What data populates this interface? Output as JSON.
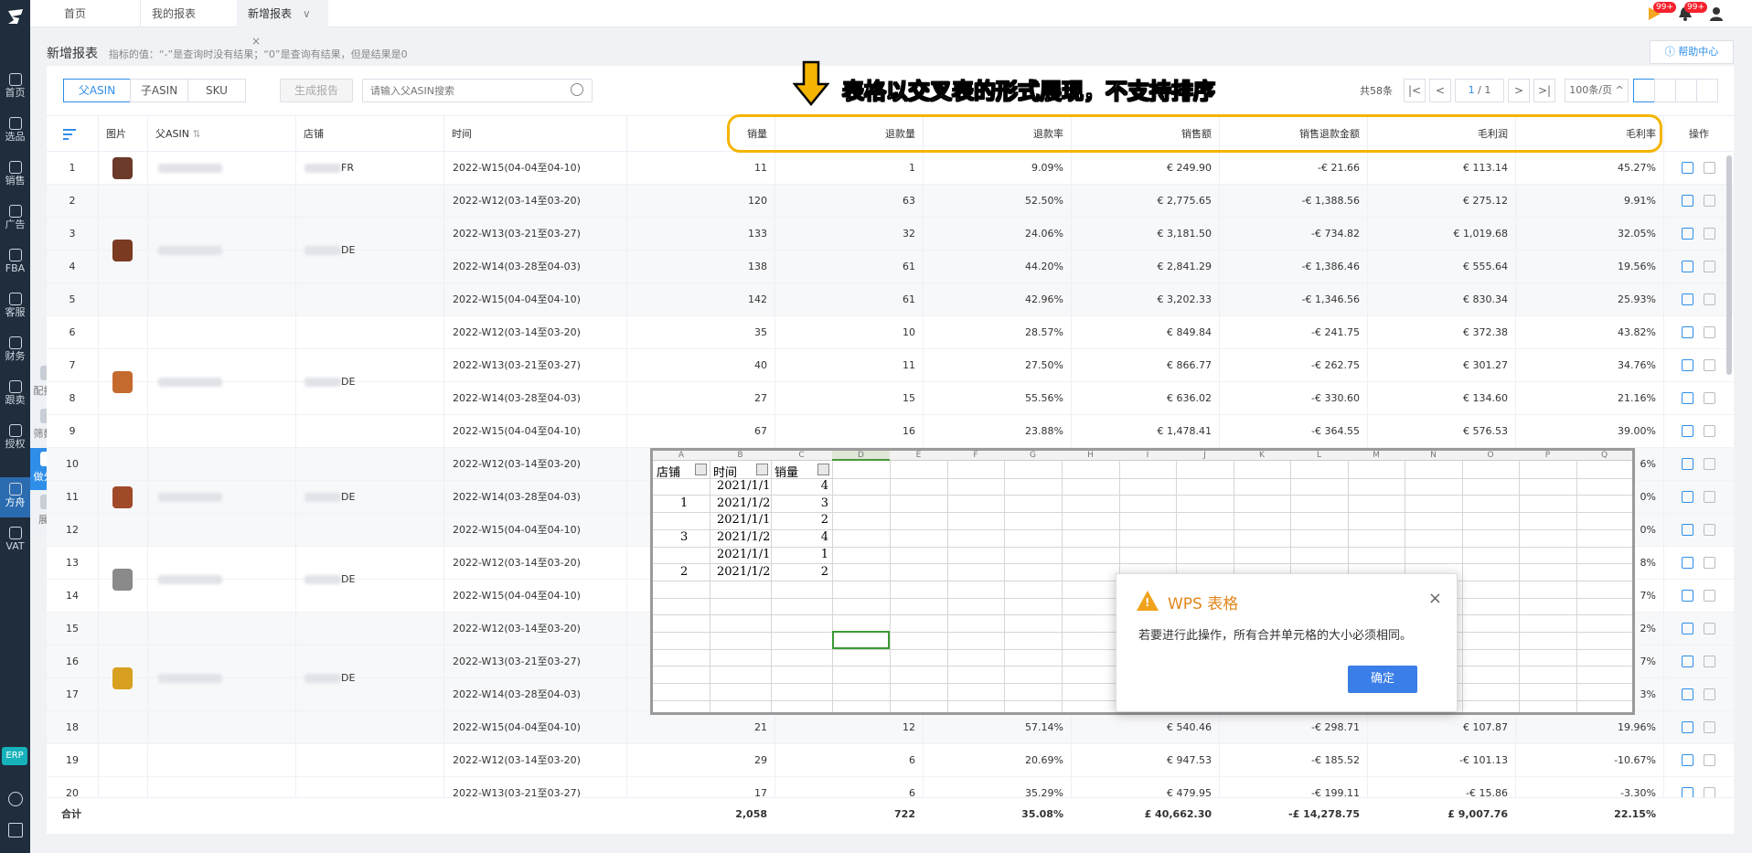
{
  "sidebar": {
    "items": [
      {
        "label": "首页",
        "icon": "home-icon"
      },
      {
        "label": "选品",
        "icon": "search-icon"
      },
      {
        "label": "销售",
        "icon": "chart-line-icon"
      },
      {
        "label": "广告",
        "icon": "ad-icon"
      },
      {
        "label": "FBA",
        "icon": "box-icon"
      },
      {
        "label": "客服",
        "icon": "service-icon"
      },
      {
        "label": "财务",
        "icon": "finance-icon"
      },
      {
        "label": "跟卖",
        "icon": "follow-sell-icon"
      },
      {
        "label": "授权",
        "icon": "shield-icon"
      },
      {
        "label": "方舟",
        "icon": "ark-icon"
      },
      {
        "label": "VAT",
        "icon": "vat-icon"
      }
    ],
    "erp_label": "ERP"
  },
  "float_tools": [
    {
      "label": "配报表",
      "icon": "pie-chart-icon"
    },
    {
      "label": "筛数据",
      "icon": "image-filter-icon"
    },
    {
      "label": "做分析",
      "icon": "analysis-icon"
    },
    {
      "label": "展开",
      "icon": "expand-icon"
    }
  ],
  "tabs": [
    {
      "label": "首页"
    },
    {
      "label": "我的报表"
    },
    {
      "label": "新增报表",
      "active": true
    }
  ],
  "tab_close": "×",
  "tab_chevron": "∨",
  "notifications": {
    "badge1": "99+",
    "badge2": "99+"
  },
  "page": {
    "title": "新增报表",
    "hint": "指标的值：“-”是查询时没有结果；“0”是查询有结果，但是结果是0",
    "help": "帮助中心"
  },
  "filters": {
    "segments": [
      "父ASIN",
      "子ASIN",
      "SKU"
    ],
    "generate": "生成报告",
    "search_placeholder": "请输入父ASIN搜索"
  },
  "annotation": "表格以交叉表的形式展现，不支持排序",
  "pagination": {
    "total": "共58条",
    "current": "1",
    "of": "/ 1",
    "page_size": "100条/页"
  },
  "table": {
    "headers": [
      "图片",
      "父ASIN",
      "店铺",
      "时间",
      "销量",
      "退款量",
      "退款率",
      "销售额",
      "销售退款金额",
      "毛利润",
      "毛利率",
      "操作"
    ],
    "rows": [
      {
        "no": "1",
        "store": "FR",
        "time": "2022-W15(04-04至04-10)",
        "sales": "11",
        "refunds": "1",
        "refund_rate": "9.09%",
        "revenue": "€ 249.90",
        "refund_amt": "-€ 21.66",
        "profit": "€ 113.14",
        "margin": "45.27%"
      },
      {
        "no": "2",
        "store": "",
        "time": "2022-W12(03-14至03-20)",
        "sales": "120",
        "refunds": "63",
        "refund_rate": "52.50%",
        "revenue": "€ 2,775.65",
        "refund_amt": "-€ 1,388.56",
        "profit": "€ 275.12",
        "margin": "9.91%"
      },
      {
        "no": "3",
        "store": "DE",
        "time": "2022-W13(03-21至03-27)",
        "sales": "133",
        "refunds": "32",
        "refund_rate": "24.06%",
        "revenue": "€ 3,181.50",
        "refund_amt": "-€ 734.82",
        "profit": "€ 1,019.68",
        "margin": "32.05%"
      },
      {
        "no": "4",
        "store": "",
        "time": "2022-W14(03-28至04-03)",
        "sales": "138",
        "refunds": "61",
        "refund_rate": "44.20%",
        "revenue": "€ 2,841.29",
        "refund_amt": "-€ 1,386.46",
        "profit": "€ 555.64",
        "margin": "19.56%"
      },
      {
        "no": "5",
        "store": "",
        "time": "2022-W15(04-04至04-10)",
        "sales": "142",
        "refunds": "61",
        "refund_rate": "42.96%",
        "revenue": "€ 3,202.33",
        "refund_amt": "-€ 1,346.56",
        "profit": "€ 830.34",
        "margin": "25.93%"
      },
      {
        "no": "6",
        "store": "",
        "time": "2022-W12(03-14至03-20)",
        "sales": "35",
        "refunds": "10",
        "refund_rate": "28.57%",
        "revenue": "€ 849.84",
        "refund_amt": "-€ 241.75",
        "profit": "€ 372.38",
        "margin": "43.82%"
      },
      {
        "no": "7",
        "store": "DE",
        "time": "2022-W13(03-21至03-27)",
        "sales": "40",
        "refunds": "11",
        "refund_rate": "27.50%",
        "revenue": "€ 866.77",
        "refund_amt": "-€ 262.75",
        "profit": "€ 301.27",
        "margin": "34.76%"
      },
      {
        "no": "8",
        "store": "",
        "time": "2022-W14(03-28至04-03)",
        "sales": "27",
        "refunds": "15",
        "refund_rate": "55.56%",
        "revenue": "€ 636.02",
        "refund_amt": "-€ 330.60",
        "profit": "€ 134.60",
        "margin": "21.16%"
      },
      {
        "no": "9",
        "store": "",
        "time": "2022-W15(04-04至04-10)",
        "sales": "67",
        "refunds": "16",
        "refund_rate": "23.88%",
        "revenue": "€ 1,478.41",
        "refund_amt": "-€ 364.55",
        "profit": "€ 576.53",
        "margin": "39.00%"
      },
      {
        "no": "10",
        "store": "",
        "time": "2022-W12(03-14至03-20)",
        "sales": "",
        "refunds": "",
        "refund_rate": "",
        "revenue": "",
        "refund_amt": "",
        "profit": "",
        "margin": "6%"
      },
      {
        "no": "11",
        "store": "DE",
        "time": "2022-W14(03-28至04-03)",
        "sales": "",
        "refunds": "",
        "refund_rate": "",
        "revenue": "",
        "refund_amt": "",
        "profit": "",
        "margin": "0%"
      },
      {
        "no": "12",
        "store": "",
        "time": "2022-W15(04-04至04-10)",
        "sales": "",
        "refunds": "",
        "refund_rate": "",
        "revenue": "",
        "refund_amt": "",
        "profit": "",
        "margin": "0%"
      },
      {
        "no": "13",
        "store": "DE",
        "time": "2022-W12(03-14至03-20)",
        "sales": "",
        "refunds": "",
        "refund_rate": "",
        "revenue": "",
        "refund_amt": "",
        "profit": "",
        "margin": "8%"
      },
      {
        "no": "14",
        "store": "",
        "time": "2022-W15(04-04至04-10)",
        "sales": "",
        "refunds": "",
        "refund_rate": "",
        "revenue": "",
        "refund_amt": "",
        "profit": "",
        "margin": "7%"
      },
      {
        "no": "15",
        "store": "",
        "time": "2022-W12(03-14至03-20)",
        "sales": "",
        "refunds": "",
        "refund_rate": "",
        "revenue": "",
        "refund_amt": "",
        "profit": "",
        "margin": "2%"
      },
      {
        "no": "16",
        "store": "DE",
        "time": "2022-W13(03-21至03-27)",
        "sales": "",
        "refunds": "",
        "refund_rate": "",
        "revenue": "",
        "refund_amt": "",
        "profit": "",
        "margin": "7%"
      },
      {
        "no": "17",
        "store": "",
        "time": "2022-W14(03-28至04-03)",
        "sales": "",
        "refunds": "",
        "refund_rate": "",
        "revenue": "",
        "refund_amt": "",
        "profit": "",
        "margin": "3%"
      },
      {
        "no": "18",
        "store": "",
        "time": "2022-W15(04-04至04-10)",
        "sales": "21",
        "refunds": "12",
        "refund_rate": "57.14%",
        "revenue": "€ 540.46",
        "refund_amt": "-€ 298.71",
        "profit": "€ 107.87",
        "margin": "19.96%"
      },
      {
        "no": "19",
        "store": "",
        "time": "2022-W12(03-14至03-20)",
        "sales": "29",
        "refunds": "6",
        "refund_rate": "20.69%",
        "revenue": "€ 947.53",
        "refund_amt": "-€ 185.52",
        "profit": "-€ 101.13",
        "margin": "-10.67%"
      },
      {
        "no": "20",
        "store": "",
        "time": "2022-W13(03-21至03-27)",
        "sales": "17",
        "refunds": "6",
        "refund_rate": "35.29%",
        "revenue": "€ 479.95",
        "refund_amt": "-€ 199.11",
        "profit": "-€ 15.86",
        "margin": "-3.30%"
      }
    ],
    "footer": {
      "label": "合计",
      "sales": "2,058",
      "refunds": "722",
      "refund_rate": "35.08%",
      "revenue": "£ 40,662.30",
      "refund_amt": "-£ 14,278.75",
      "profit": "£ 9,007.76",
      "margin": "22.15%"
    }
  },
  "excel": {
    "col_letters": [
      "A",
      "B",
      "C",
      "D",
      "E",
      "F",
      "G",
      "H",
      "I",
      "J",
      "K",
      "L",
      "M",
      "N",
      "O",
      "P",
      "Q"
    ],
    "headers": [
      "店铺",
      "时间",
      "销量"
    ],
    "rows": [
      {
        "store": "",
        "date": "2021/1/1",
        "qty": "4"
      },
      {
        "store": "1",
        "date": "2021/1/2",
        "qty": "3"
      },
      {
        "store": "",
        "date": "2021/1/1",
        "qty": "2"
      },
      {
        "store": "3",
        "date": "2021/1/2",
        "qty": "4"
      },
      {
        "store": "",
        "date": "2021/1/1",
        "qty": "1"
      },
      {
        "store": "2",
        "date": "2021/1/2",
        "qty": "2"
      }
    ]
  },
  "dialog": {
    "title": "WPS 表格",
    "message": "若要进行此操作，所有合并单元格的大小必须相同。",
    "ok": "确定",
    "close": "×"
  },
  "colors": {
    "accent": "#2f8ee8",
    "highlight": "#f5b400",
    "warn": "#e2861b",
    "sidebar": "#1f2d3d"
  }
}
